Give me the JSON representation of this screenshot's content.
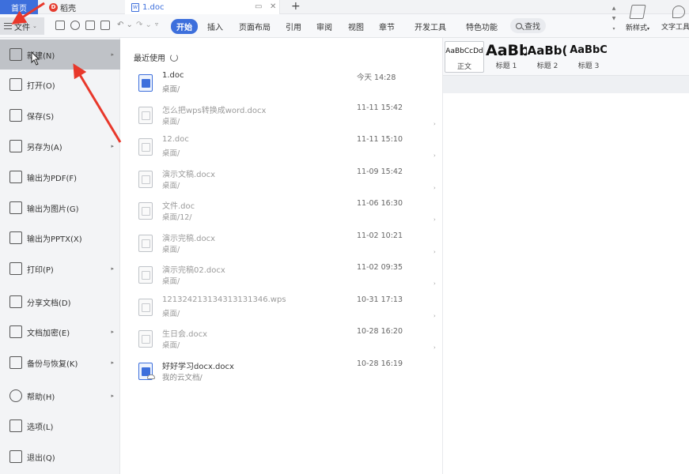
{
  "tabs": {
    "home": "首页",
    "daoke": "稻壳",
    "doc": "1.doc"
  },
  "ribbon": {
    "file": "文件",
    "tabs": [
      "开始",
      "插入",
      "页面布局",
      "引用",
      "审阅",
      "视图",
      "章节",
      "开发工具",
      "特色功能"
    ],
    "search": "查找",
    "accent": "#3d6fdc"
  },
  "styles": {
    "items": [
      {
        "sample": "AaBbCcDd",
        "name": "正文"
      },
      {
        "sample": "AaBb",
        "name": "标题 1"
      },
      {
        "sample": "AaBb(",
        "name": "标题 2"
      },
      {
        "sample": "AaBbC",
        "name": "标题 3"
      }
    ],
    "new_style": "新样式",
    "text_tool": "文字工具"
  },
  "file_menu": {
    "items": [
      {
        "label": "新建(N)",
        "icon": "new-doc-icon",
        "arrow": true
      },
      {
        "label": "打开(O)",
        "icon": "folder-open-icon",
        "arrow": false
      },
      {
        "label": "保存(S)",
        "icon": "save-icon",
        "arrow": false
      },
      {
        "label": "另存为(A)",
        "icon": "save-as-icon",
        "arrow": true
      },
      {
        "label": "输出为PDF(F)",
        "icon": "pdf-icon",
        "arrow": false
      },
      {
        "label": "输出为图片(G)",
        "icon": "image-icon",
        "arrow": false
      },
      {
        "label": "输出为PPTX(X)",
        "icon": "pptx-icon",
        "arrow": false
      },
      {
        "label": "打印(P)",
        "icon": "printer-icon",
        "arrow": true
      },
      {
        "label": "分享文档(D)",
        "icon": "share-icon",
        "arrow": false
      },
      {
        "label": "文档加密(E)",
        "icon": "encrypt-icon",
        "arrow": true
      },
      {
        "label": "备份与恢复(K)",
        "icon": "backup-icon",
        "arrow": true
      },
      {
        "label": "帮助(H)",
        "icon": "help-icon",
        "arrow": true
      },
      {
        "label": "选项(L)",
        "icon": "gear-icon",
        "arrow": false
      },
      {
        "label": "退出(Q)",
        "icon": "exit-icon",
        "arrow": false
      }
    ]
  },
  "recent": {
    "title": "最近使用",
    "files": [
      {
        "name": "1.doc",
        "path": "桌面/",
        "time": "今天 14:28",
        "type": "doc"
      },
      {
        "name": "怎么把wps转换成word.docx",
        "path": "桌面/",
        "time": "11-11 15:42",
        "type": "docx"
      },
      {
        "name": "12.doc",
        "path": "桌面/",
        "time": "11-11 15:10",
        "type": "docx"
      },
      {
        "name": "演示文稿.docx",
        "path": "桌面/",
        "time": "11-09 15:42",
        "type": "docx"
      },
      {
        "name": "文件.doc",
        "path": "桌面/12/",
        "time": "11-06 16:30",
        "type": "docx"
      },
      {
        "name": "演示完稿.docx",
        "path": "桌面/",
        "time": "11-02 10:21",
        "type": "docx"
      },
      {
        "name": "演示完稿02.docx",
        "path": "桌面/",
        "time": "11-02 09:35",
        "type": "docx"
      },
      {
        "name": "12132421313431313​1346.wps",
        "path": "桌面/",
        "time": "10-31 17:13",
        "type": "wps"
      },
      {
        "name": "生日会.docx",
        "path": "桌面/",
        "time": "10-28 16:20",
        "type": "docx"
      },
      {
        "name": "好好学习docx.docx",
        "path": "我的云文档/",
        "time": "10-28 16:19",
        "type": "cloud"
      }
    ]
  }
}
